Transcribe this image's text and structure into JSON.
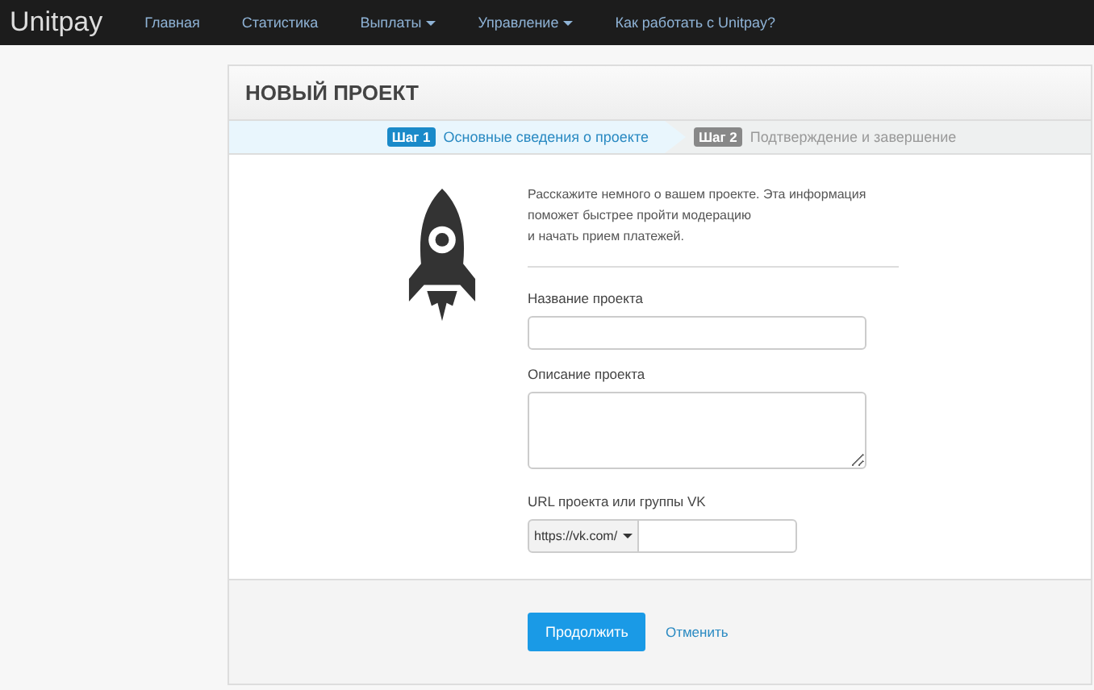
{
  "navbar": {
    "brand": "Unitpay",
    "items": [
      {
        "label": "Главная",
        "dropdown": false
      },
      {
        "label": "Статистика",
        "dropdown": false
      },
      {
        "label": "Выплаты",
        "dropdown": true
      },
      {
        "label": "Управление",
        "dropdown": true
      },
      {
        "label": "Как работать с Unitpay?",
        "dropdown": false
      }
    ]
  },
  "panel": {
    "title": "НОВЫЙ ПРОЕКТ",
    "steps": [
      {
        "badge": "Шаг 1",
        "label": "Основные сведения о проекте",
        "selected": true
      },
      {
        "badge": "Шаг 2",
        "label": "Подтверждение и завершение",
        "selected": false
      }
    ],
    "intro_lines": [
      "Расскажите немного о вашем проекте. Эта информация",
      "поможет быстрее пройти модерацию",
      "и начать прием платежей."
    ],
    "fields": [
      {
        "kind": "text",
        "label": "Название проекта"
      },
      {
        "kind": "textarea",
        "label": "Описание проекта"
      },
      {
        "kind": "url",
        "label": "URL проекта или группы VK",
        "prefix": "https://vk.com/"
      }
    ],
    "buttons": {
      "submit": "Продолжить",
      "cancel": "Отменить"
    }
  }
}
